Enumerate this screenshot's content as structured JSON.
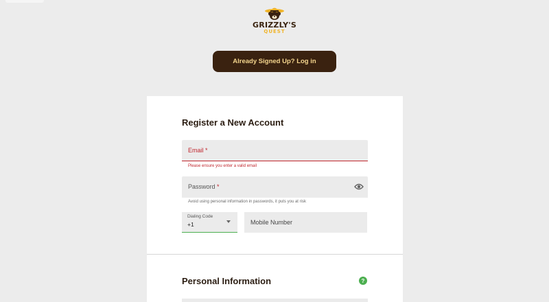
{
  "brand": {
    "name": "GRIZZLY'S",
    "sub": "QUEST",
    "colors": {
      "dark_brown": "#3a2210",
      "gold": "#f0b429",
      "error_red": "#c0262d",
      "success_green": "#4caf50"
    }
  },
  "header": {
    "login_label": "Already Signed Up? Log in"
  },
  "register": {
    "title": "Register a New Account",
    "email": {
      "label": "Email",
      "required_mark": "*",
      "error": "Please ensure you enter a valid email"
    },
    "password": {
      "label": "Password",
      "required_mark": "*",
      "hint": "Avoid using personal information in passwords, it puts you at risk",
      "toggle_icon": "eye-icon"
    },
    "dialing_code": {
      "label": "Dialing Code",
      "value": "+1"
    },
    "mobile": {
      "label": "Mobile Number"
    }
  },
  "personal": {
    "title": "Personal Information",
    "help_icon": "help-icon",
    "help_glyph": "?"
  }
}
